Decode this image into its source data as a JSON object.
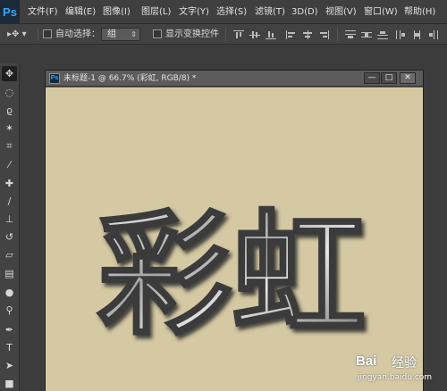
{
  "app": {
    "logo": "Ps",
    "menu": [
      {
        "label": "文件(F)"
      },
      {
        "label": "编辑(E)"
      },
      {
        "label": "图像(I)"
      },
      {
        "label": "图层(L)"
      },
      {
        "label": "文字(Y)"
      },
      {
        "label": "选择(S)"
      },
      {
        "label": "滤镜(T)"
      },
      {
        "label": "3D(D)"
      },
      {
        "label": "视图(V)"
      },
      {
        "label": "窗口(W)"
      },
      {
        "label": "帮助(H)"
      }
    ]
  },
  "options": {
    "auto_select_label": "自动选择：",
    "group_value": "组",
    "show_transform_label": "显示变换控件"
  },
  "tools": [
    {
      "icon": "move-icon",
      "glyph": "✥"
    },
    {
      "icon": "marquee-icon",
      "glyph": "◌"
    },
    {
      "icon": "lasso-icon",
      "glyph": "ϱ"
    },
    {
      "icon": "magic-wand-icon",
      "glyph": "✶"
    },
    {
      "icon": "crop-icon",
      "glyph": "⌗"
    },
    {
      "icon": "eyedropper-icon",
      "glyph": "⁄"
    },
    {
      "icon": "healing-brush-icon",
      "glyph": "✚"
    },
    {
      "icon": "brush-icon",
      "glyph": "∕"
    },
    {
      "icon": "clone-stamp-icon",
      "glyph": "⊥"
    },
    {
      "icon": "history-brush-icon",
      "glyph": "↺"
    },
    {
      "icon": "eraser-icon",
      "glyph": "▱"
    },
    {
      "icon": "gradient-icon",
      "glyph": "▤"
    },
    {
      "icon": "blur-icon",
      "glyph": "●"
    },
    {
      "icon": "dodge-icon",
      "glyph": "⚲"
    },
    {
      "icon": "pen-icon",
      "glyph": "✒"
    },
    {
      "icon": "type-icon",
      "glyph": "T"
    },
    {
      "icon": "path-selection-icon",
      "glyph": "➤"
    },
    {
      "icon": "rectangle-icon",
      "glyph": "■"
    }
  ],
  "document": {
    "title": "未标题-1 @ 66.7% (彩虹, RGB/8) *",
    "canvas_text": "彩虹",
    "canvas_color": "#d5c9a4"
  },
  "watermark": {
    "brand": "Bai",
    "brand_suffix": "经验",
    "url": "jingyan.baidu.com"
  }
}
